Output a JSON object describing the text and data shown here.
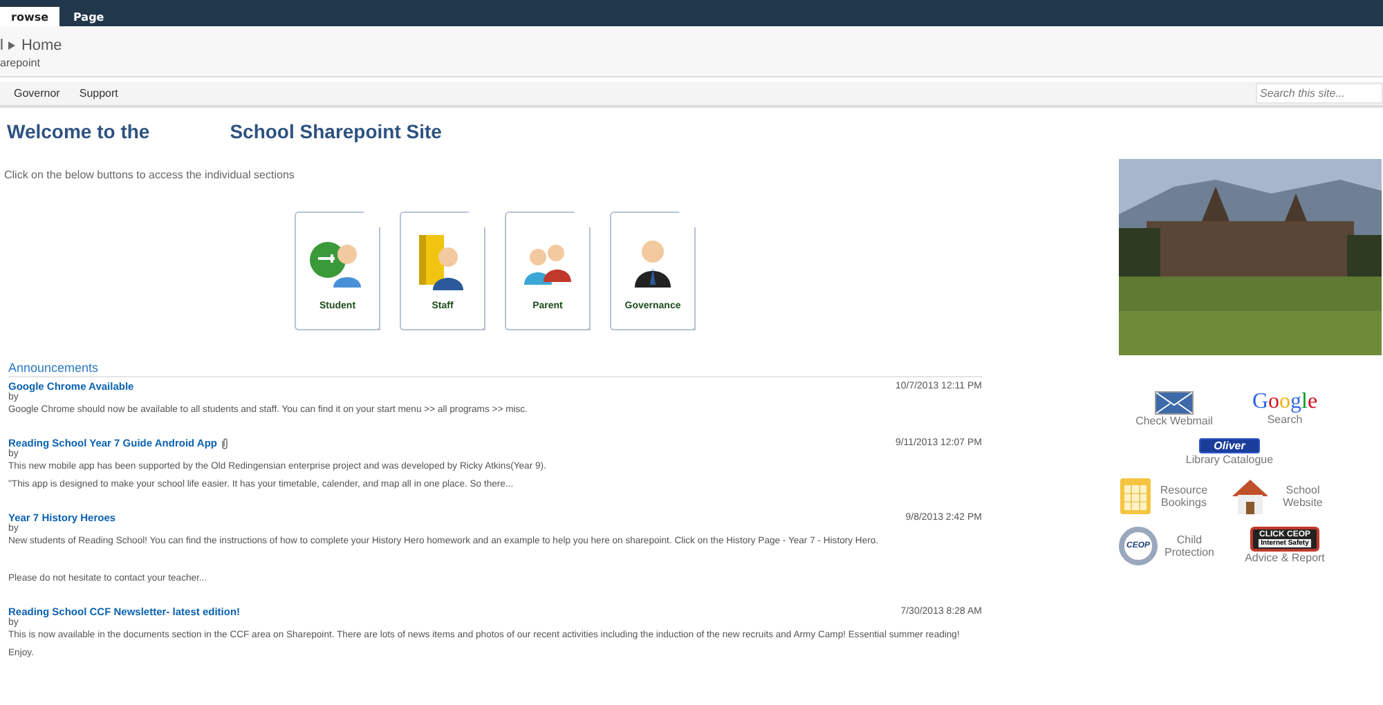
{
  "ribbon": {
    "tabs": [
      {
        "label": "rowse",
        "selected": true
      },
      {
        "label": "Page",
        "selected": false
      }
    ]
  },
  "breadcrumb": {
    "root": "l",
    "current": "Home",
    "subtitle": "arepoint"
  },
  "nav": {
    "items": [
      "Governor",
      "Support"
    ],
    "search": {
      "placeholder": "Search this site..."
    }
  },
  "welcome": {
    "title_left": "Welcome to the",
    "title_right": "School Sharepoint Site",
    "intro": "Click on the below buttons to access the individual sections"
  },
  "sections": [
    {
      "kind": "student",
      "label": "Student"
    },
    {
      "kind": "staff",
      "label": "Staff"
    },
    {
      "kind": "parent",
      "label": "Parent"
    },
    {
      "kind": "governance",
      "label": "Governance"
    }
  ],
  "announcements": {
    "title": "Announcements",
    "items": [
      {
        "title": "Google Chrome Available",
        "attachment": false,
        "date": "10/7/2013 12:11 PM",
        "by": "by",
        "body": [
          "Google Chrome should now be available to all students and staff. You can find it on your start menu >> all programs >> misc."
        ]
      },
      {
        "title": "Reading School Year 7 Guide Android App",
        "attachment": true,
        "date": "9/11/2013 12:07 PM",
        "by": "by",
        "body": [
          "This new mobile app has been supported by the Old Redingensian enterprise project and was developed by Ricky Atkins(Year 9).",
          "\"This app is designed to make your school life easier. It has your timetable, calender, and map all in one place. So there..."
        ]
      },
      {
        "title": "Year 7 History Heroes",
        "attachment": false,
        "date": "9/8/2013 2:42 PM",
        "by": "by",
        "body": [
          "New students of Reading School! You can find the instructions of how to complete your History Hero homework and an example to help you here on sharepoint. Click on the History Page - Year 7 - History Hero.",
          "Please do not hesitate to contact your teacher..."
        ]
      },
      {
        "title": "Reading School CCF Newsletter- latest edition!",
        "attachment": false,
        "date": "7/30/2013 8:28 AM",
        "by": "by",
        "body": [
          "This is now available in the documents section in the CCF area on Sharepoint. There are lots of news items and photos of our recent activities including the induction of the new recruits and Army Camp! Essential summer reading!",
          "Enjoy."
        ]
      }
    ]
  },
  "side": {
    "quick_links": [
      {
        "kind": "mail",
        "label": "Check Webmail"
      },
      {
        "kind": "google",
        "logo": "Google",
        "label": "Search"
      },
      {
        "kind": "oliver",
        "logo": "Oliver",
        "label": "Library Catalogue"
      },
      {
        "kind": "calendar",
        "label": "Resource Bookings"
      },
      {
        "kind": "house",
        "label": "School Website"
      },
      {
        "kind": "ceop",
        "logo": "CEOP",
        "label": "Child Protection"
      },
      {
        "kind": "clickceop",
        "logo": "CLICK CEOP",
        "sublogo": "Internet Safety",
        "label": "Advice & Report"
      }
    ]
  }
}
